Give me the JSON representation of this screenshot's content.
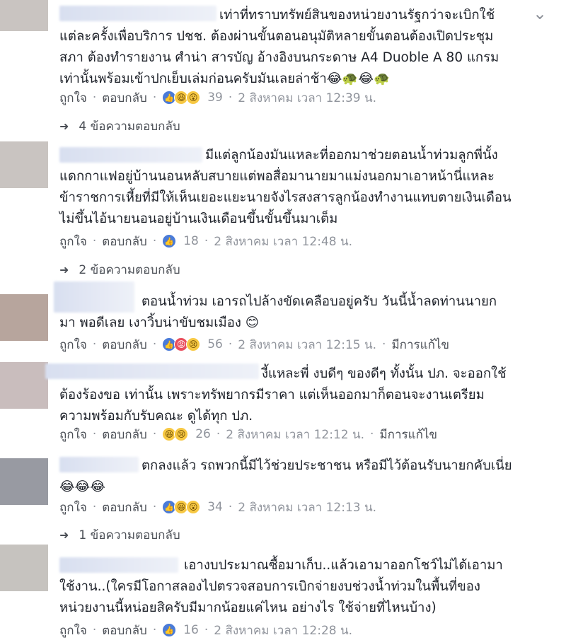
{
  "comments": [
    {
      "avatar_color": "#c2bbb6",
      "text": "เท่าที่ทราบทรัพย์สินของหน่วยงานรัฐกว่าจะเบิกใช้แต่ละครั้งเพื่อบริการ ปชช. ต้องผ่านขั้นตอนอนุมัติหลายขั้นตอนต้องเปิดประชุมสภา ต้องทำรายงาน ศำน่า สารบัญ อ้างอิงบนกระดาษ A4 Duoble A 80 แกรมเท่านั้นพร้อมเข้าปกเย็บเล่มก่อนครับมันเลยล่าช้า😂🐢😂🐢",
      "like": "ถูกใจ",
      "reply": "ตอบกลับ",
      "reactions": [
        "like-icon",
        "haha-icon",
        "wow-icon"
      ],
      "count": "39",
      "time": "2 สิงหาคม เวลา 12:39 น.",
      "edited": "",
      "replies": "4 ข้อความตอบกลับ"
    },
    {
      "avatar_color": "#bfbdb5",
      "text": "มีแต่ลูกน้องมันแหละที่ออกมาช่วยตอนน้ำท่วมลูกพี่นั้งแดกกาแฟอยู่บ้านนอนหลับสบายแต่พอสื่อมานายมาแม่งนอกมาเอาหน้านี่แหละข้าราชการเหี้ยที่มีให้เห็นเยอะแยะนายจังไรสงสารลูกน้องทำงานแทบตายเงินเดือนไม่ขึ้นไอ้นายนอนอยู่บ้านเงินเดือนขึ้นขั้นขึ้นมาเต็ม",
      "like": "ถูกใจ",
      "reply": "ตอบกลับ",
      "reactions": [
        "like-icon"
      ],
      "count": "18",
      "time": "2 สิงหาคม เวลา 12:48 น.",
      "edited": "",
      "replies": "2 ข้อความตอบกลับ"
    },
    {
      "avatar_color": "#b9a8a0",
      "text": "ตอนน้ำท่วม เอารถไปล้างขัดเคลือบอยู่ครับ วันนี้น้ำลดท่านนายกมา พอดีเลย เงาวิ้บน่าขับชมเมือง 😊",
      "like": "ถูกใจ",
      "reply": "ตอบกลับ",
      "reactions": [
        "like-icon",
        "love-icon",
        "sad-icon"
      ],
      "count": "56",
      "time": "2 สิงหาคม เวลา 12:15 น.",
      "edited": "มีการแก้ไข",
      "replies": ""
    },
    {
      "avatar_color": "#c8bcbc",
      "text": "งี้แหละพี่ งบดีๆ ของดีๆ ทั้งนั้น ปภ. จะออกใช้ต้องร้องขอ เท่านั้น เพราะทรัพยากรมีราคา แต่เห็นออกมาก็ตอนจะงานเตรียมความพร้อมกับรับคณะ ดูได้ทุก ปภ.",
      "like": "ถูกใจ",
      "reply": "ตอบกลับ",
      "reactions": [
        "haha-icon",
        "sad-icon"
      ],
      "count": "26",
      "time": "2 สิงหาคม เวลา 12:12 น.",
      "edited": "มีการแก้ไข",
      "replies": ""
    },
    {
      "avatar_color": "#9a9ca3",
      "text": "ตกลงแล้ว รถพวกนี้มีไว้ช่วยประชาชน หรือมีไว้ต้อนรับนายกคับเนี่ย😂😂😂",
      "like": "ถูกใจ",
      "reply": "ตอบกลับ",
      "reactions": [
        "like-icon",
        "haha-icon",
        "wow-icon"
      ],
      "count": "34",
      "time": "2 สิงหาคม เวลา 12:13 น.",
      "edited": "",
      "replies": "1 ข้อความตอบกลับ"
    },
    {
      "avatar_color": "#c7c4c0",
      "text": "เอางบประมาณซื้อมาเก็บ..แล้วเอามาออกโชว์ไม่ได้เอามาใช้งาน..(ใครมีโอกาสลองไปตรวจสอบการเบิกจ่ายงบช่วงน้ำท่วมในพื้นที่ของหน่วยงานนี้หน่อยสิครับมีมากน้อยแค่ไหน อย่างไร ใช้จ่ายที่ไหนบ้าง)",
      "like": "ถูกใจ",
      "reply": "ตอบกลับ",
      "reactions": [
        "like-icon"
      ],
      "count": "16",
      "time": "2 สิงหาคม เวลา 12:28 น.",
      "edited": "",
      "replies": ""
    }
  ]
}
